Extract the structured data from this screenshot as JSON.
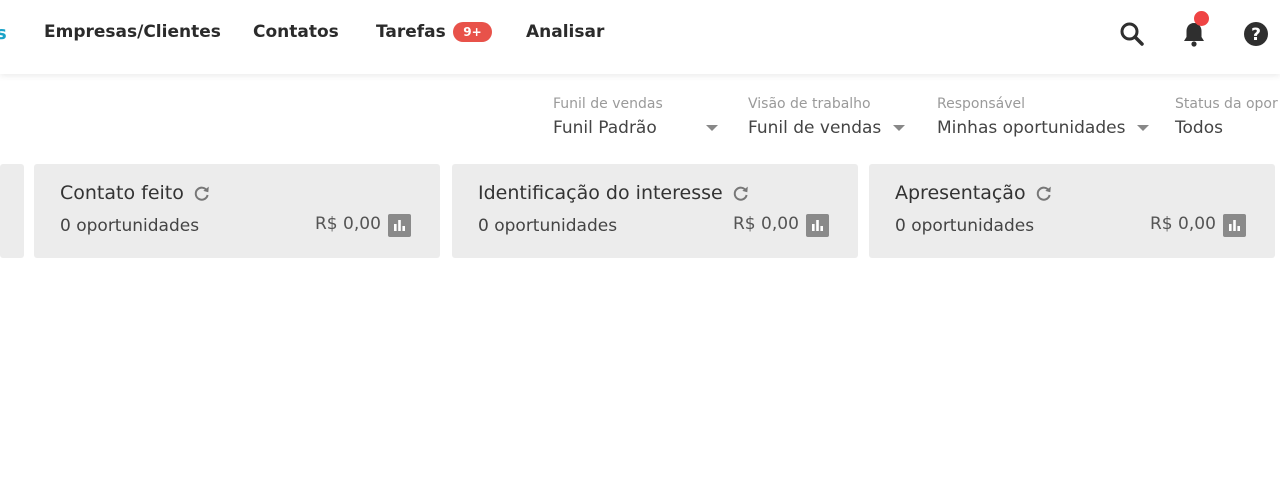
{
  "nav": {
    "cut_label": "s",
    "items": [
      {
        "label": "Empresas/Clientes"
      },
      {
        "label": "Contatos"
      },
      {
        "label": "Tarefas",
        "badge": "9+"
      },
      {
        "label": "Analisar"
      }
    ],
    "icons": [
      "search-icon",
      "bell-icon",
      "help-icon"
    ],
    "colors": {
      "accent": "#1aa3c8",
      "badge": "#e8524a",
      "notification_dot": "#ef4444"
    }
  },
  "filters": [
    {
      "label": "Funil de vendas",
      "value": "Funil Padrão"
    },
    {
      "label": "Visão de trabalho",
      "value": "Funil de vendas"
    },
    {
      "label": "Responsável",
      "value": "Minhas oportunidades"
    },
    {
      "label": "Status da opor",
      "value": "Todos"
    }
  ],
  "stages": [
    {
      "title": "Contato feito",
      "count": "0 oportunidades",
      "total": "R$ 0,00"
    },
    {
      "title": "Identificação do interesse",
      "count": "0 oportunidades",
      "total": "R$ 0,00"
    },
    {
      "title": "Apresentação",
      "count": "0 oportunidades",
      "total": "R$ 0,00"
    }
  ]
}
